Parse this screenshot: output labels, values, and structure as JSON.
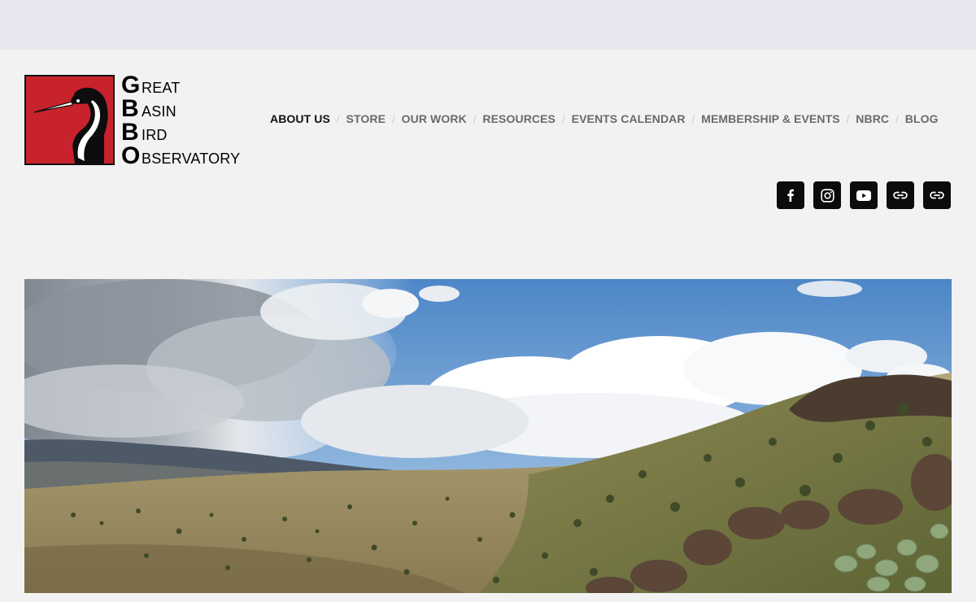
{
  "site": {
    "logo": {
      "lines": [
        {
          "cap": "G",
          "rest": "REAT"
        },
        {
          "cap": "B",
          "rest": "ASIN"
        },
        {
          "cap": "B",
          "rest": "IRD"
        },
        {
          "cap": "O",
          "rest": "BSERVATORY"
        }
      ]
    }
  },
  "nav": {
    "items": [
      {
        "label": "ABOUT US",
        "active": true
      },
      {
        "label": "STORE"
      },
      {
        "label": "OUR WORK"
      },
      {
        "label": "RESOURCES"
      },
      {
        "label": "EVENTS CALENDAR"
      },
      {
        "label": "MEMBERSHIP & EVENTS"
      },
      {
        "label": "NBRC"
      },
      {
        "label": "BLOG"
      }
    ],
    "separator": "/"
  },
  "social": {
    "icons": [
      "facebook-icon",
      "instagram-icon",
      "youtube-icon",
      "link-icon",
      "link-icon"
    ]
  },
  "colors": {
    "logo_red": "#c8222c",
    "nav_active": "#111111",
    "nav_inactive": "#6a6a6a",
    "social_bg": "#0c0c0c"
  }
}
